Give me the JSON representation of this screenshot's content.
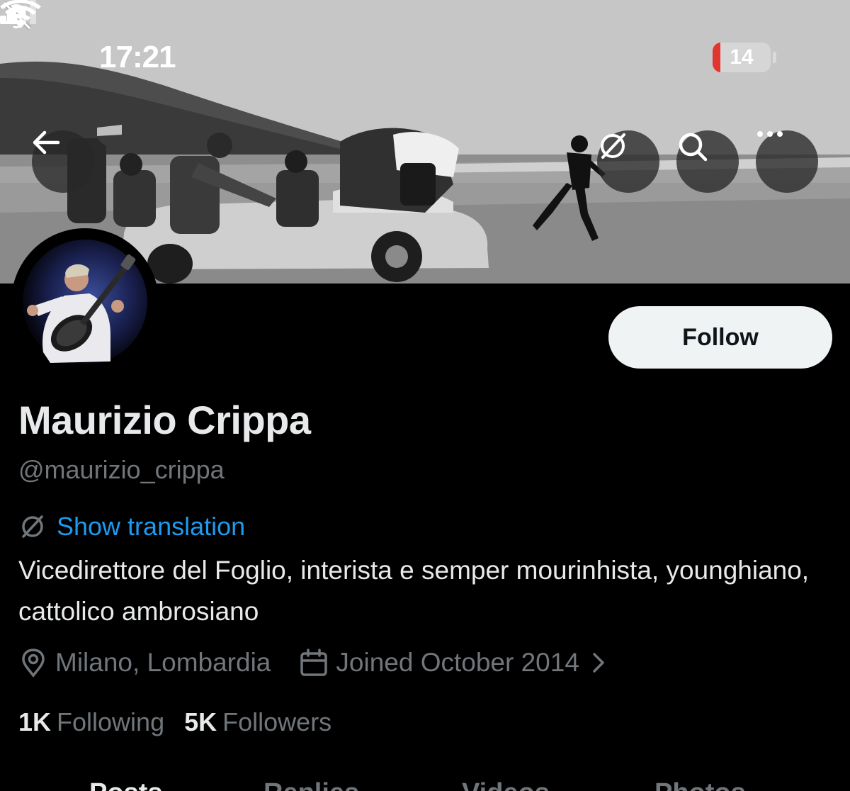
{
  "status_bar": {
    "time": "17:21",
    "battery_level": "14",
    "battery_fraction": 0.14,
    "battery_color": "#e0362f",
    "icons": [
      "bell-slash-icon",
      "cellular-signal-icon",
      "wifi-icon",
      "battery-icon"
    ]
  },
  "header": {
    "buttons": [
      "back-arrow-icon",
      "translate-icon",
      "search-icon",
      "more-icon"
    ]
  },
  "profile": {
    "name": "Maurizio Crippa",
    "handle": "@maurizio_crippa",
    "follow_label": "Follow",
    "show_translation": "Show translation",
    "bio": "Vicedirettore del Foglio, interista e semper mourinhista, younghiano, cattolico ambrosiano",
    "location": "Milano, Lombardia",
    "joined": "Joined October 2014",
    "following_count": "1K",
    "following_label": "Following",
    "followers_count": "5K",
    "followers_label": "Followers"
  },
  "tabs": [
    "Posts",
    "Replies",
    "Videos",
    "Photos"
  ],
  "colors": {
    "background": "#000000",
    "text_primary": "#e7e9ea",
    "text_secondary": "#71767b",
    "link": "#1d9bf0",
    "follow_button_bg": "#eff3f4"
  }
}
